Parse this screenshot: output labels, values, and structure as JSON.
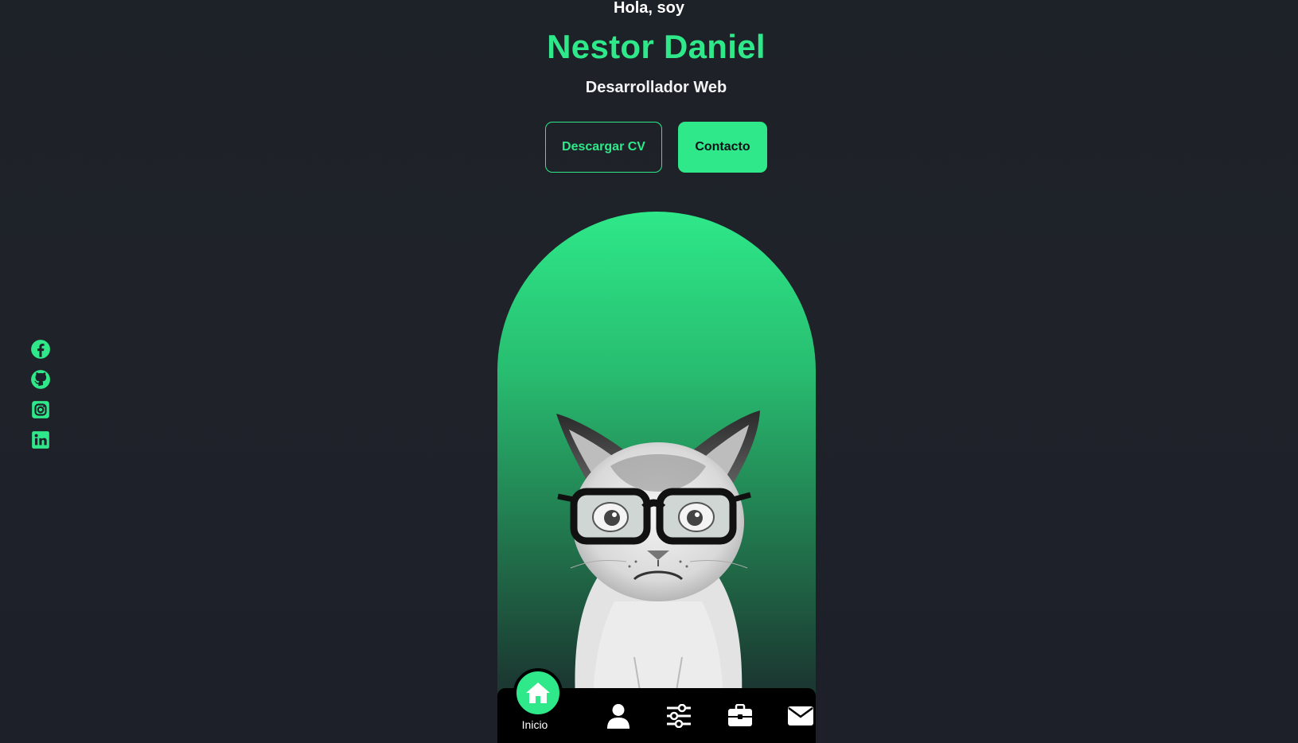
{
  "hero": {
    "greeting": "Hola, soy",
    "name": "Nestor Daniel",
    "role": "Desarrollador Web"
  },
  "buttons": {
    "download_cv": "Descargar CV",
    "contact": "Contacto"
  },
  "socials": [
    {
      "icon": "facebook-icon"
    },
    {
      "icon": "github-icon"
    },
    {
      "icon": "instagram-icon"
    },
    {
      "icon": "linkedin-icon"
    }
  ],
  "nav": {
    "items": [
      {
        "label": "Inicio",
        "icon": "home-icon",
        "active": true
      },
      {
        "icon": "user-icon"
      },
      {
        "icon": "sliders-icon"
      },
      {
        "icon": "briefcase-icon"
      },
      {
        "icon": "envelope-icon"
      }
    ]
  },
  "colors": {
    "accent": "#2ee889",
    "background": "#1e2129",
    "nav_background": "#000000"
  }
}
